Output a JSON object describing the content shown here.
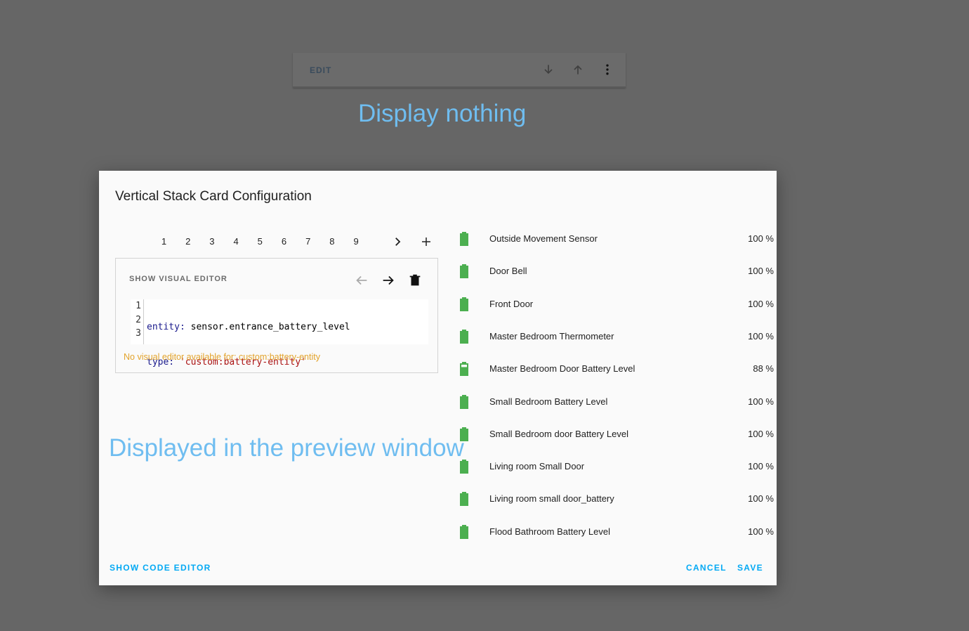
{
  "background_card": {
    "edit_label": "EDIT"
  },
  "annotations": {
    "top": "Display nothing",
    "middle": "Displayed in the preview window"
  },
  "dialog": {
    "title": "Vertical Stack Card Configuration",
    "tabs": [
      "1",
      "2",
      "3",
      "4",
      "5",
      "6",
      "7",
      "8",
      "9"
    ],
    "active_tab": "1",
    "editor": {
      "show_visual_label": "SHOW VISUAL EDITOR",
      "line_numbers": [
        "1",
        "2",
        "3"
      ],
      "code": {
        "line1_key": "entity:",
        "line1_value": " sensor.entrance_battery_level",
        "line2_key": "type:",
        "line2_value": " 'custom:battery-entity'"
      },
      "warning": "No visual editor available for: custom:battery-entity"
    },
    "entities": [
      {
        "name": "Outside Movement Sensor",
        "value": "100 %",
        "level": 100
      },
      {
        "name": "Door Bell",
        "value": "100 %",
        "level": 100
      },
      {
        "name": "Front Door",
        "value": "100 %",
        "level": 100
      },
      {
        "name": "Master Bedroom Thermometer",
        "value": "100 %",
        "level": 100
      },
      {
        "name": "Master Bedroom Door Battery Level",
        "value": "88 %",
        "level": 88
      },
      {
        "name": "Small Bedroom Battery Level",
        "value": "100 %",
        "level": 100
      },
      {
        "name": "Small Bedroom door Battery Level",
        "value": "100 %",
        "level": 100
      },
      {
        "name": "Living room Small Door",
        "value": "100 %",
        "level": 100
      },
      {
        "name": "Living room small door_battery",
        "value": "100 %",
        "level": 100
      },
      {
        "name": "Flood Bathroom Battery Level",
        "value": "100 %",
        "level": 100
      }
    ],
    "footer": {
      "show_code_label": "SHOW CODE EDITOR",
      "cancel_label": "CANCEL",
      "save_label": "SAVE"
    }
  },
  "colors": {
    "accent": "#03a9f4",
    "battery": "#4caf50",
    "warning": "#e3a32b",
    "annotation": "#6fbdf0"
  }
}
